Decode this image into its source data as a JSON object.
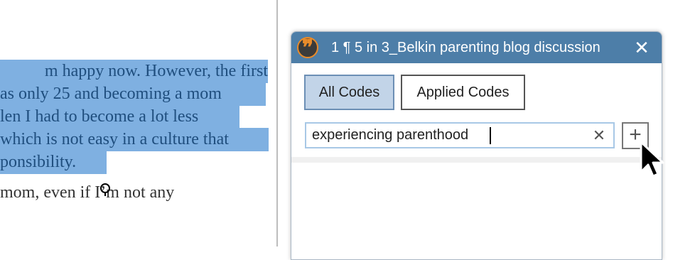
{
  "document": {
    "lines": [
      "m happy now. However, the first",
      "as only 25 and becoming a mom",
      "len I had to become a lot less",
      "which is not easy in a culture that",
      "ponsibility.",
      "mom, even if I’m not any"
    ]
  },
  "dialog": {
    "title": "1 ¶ 5 in 3_Belkin parenting blog discussion",
    "tabs": [
      {
        "label": "All Codes",
        "active": true
      },
      {
        "label": "Applied Codes",
        "active": false
      }
    ],
    "search": {
      "value": "experiencing parenthood",
      "clear_symbol": "✕"
    },
    "add_symbol": "+",
    "close_symbol": "✕",
    "icon_symbol": "❞"
  },
  "colors": {
    "titlebar": "#4d7ea8",
    "selection": "#7fb0e1",
    "active_tab": "#c2d4e8",
    "icon_accent": "#e98b2a"
  }
}
